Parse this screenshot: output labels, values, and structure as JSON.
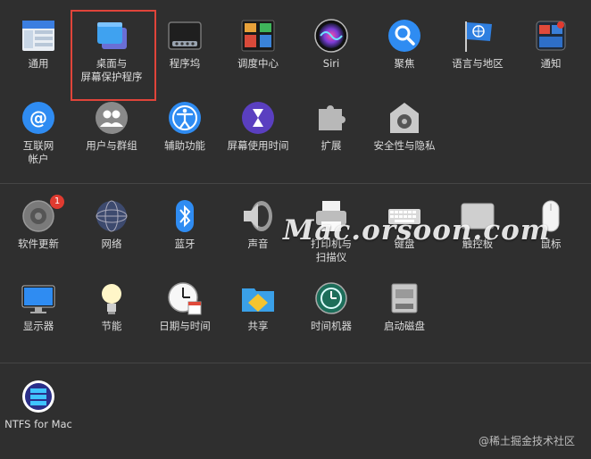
{
  "rows": {
    "row1": [
      {
        "name": "general-pane",
        "icon": "general-icon",
        "label": "通用"
      },
      {
        "name": "desktop-screensaver-pane",
        "icon": "desktop-screensaver-icon",
        "label": "桌面与\n屏幕保护程序"
      },
      {
        "name": "dock-pane",
        "icon": "dock-icon",
        "label": "程序坞"
      },
      {
        "name": "mission-control-pane",
        "icon": "mission-control-icon",
        "label": "调度中心"
      },
      {
        "name": "siri-pane",
        "icon": "siri-icon",
        "label": "Siri"
      },
      {
        "name": "spotlight-pane",
        "icon": "spotlight-icon",
        "label": "聚焦"
      },
      {
        "name": "language-region-pane",
        "icon": "language-region-icon",
        "label": "语言与地区"
      },
      {
        "name": "notifications-pane",
        "icon": "notifications-icon",
        "label": "通知"
      }
    ],
    "row2": [
      {
        "name": "internet-accounts-pane",
        "icon": "internet-accounts-icon",
        "label": "互联网\n帐户"
      },
      {
        "name": "users-groups-pane",
        "icon": "users-groups-icon",
        "label": "用户与群组"
      },
      {
        "name": "accessibility-pane",
        "icon": "accessibility-icon",
        "label": "辅助功能"
      },
      {
        "name": "screen-time-pane",
        "icon": "screen-time-icon",
        "label": "屏幕使用时间"
      },
      {
        "name": "extensions-pane",
        "icon": "extensions-icon",
        "label": "扩展"
      },
      {
        "name": "security-privacy-pane",
        "icon": "security-privacy-icon",
        "label": "安全性与隐私"
      }
    ],
    "row3": [
      {
        "name": "software-update-pane",
        "icon": "software-update-icon",
        "label": "软件更新",
        "badge": "1"
      },
      {
        "name": "network-pane",
        "icon": "network-icon",
        "label": "网络"
      },
      {
        "name": "bluetooth-pane",
        "icon": "bluetooth-icon",
        "label": "蓝牙"
      },
      {
        "name": "sound-pane",
        "icon": "sound-icon",
        "label": "声音"
      },
      {
        "name": "printers-scanners-pane",
        "icon": "printer-icon",
        "label": "打印机与\n扫描仪"
      },
      {
        "name": "keyboard-pane",
        "icon": "keyboard-icon",
        "label": "键盘"
      },
      {
        "name": "trackpad-pane",
        "icon": "trackpad-icon",
        "label": "触控板"
      },
      {
        "name": "mouse-pane",
        "icon": "mouse-icon",
        "label": "鼠标"
      }
    ],
    "row4": [
      {
        "name": "displays-pane",
        "icon": "displays-icon",
        "label": "显示器"
      },
      {
        "name": "energy-saver-pane",
        "icon": "energy-saver-icon",
        "label": "节能"
      },
      {
        "name": "date-time-pane",
        "icon": "date-time-icon",
        "label": "日期与时间"
      },
      {
        "name": "sharing-pane",
        "icon": "sharing-icon",
        "label": "共享"
      },
      {
        "name": "time-machine-pane",
        "icon": "time-machine-icon",
        "label": "时间机器"
      },
      {
        "name": "startup-disk-pane",
        "icon": "startup-disk-icon",
        "label": "启动磁盘"
      }
    ],
    "row5": [
      {
        "name": "ntfs-for-mac-pane",
        "icon": "ntfs-icon",
        "label": "NTFS for Mac"
      }
    ]
  },
  "watermark": "Mac.orsoon.com",
  "credit": "@稀土掘金技术社区",
  "colors": {
    "background": "#2f2f2f",
    "highlight": "#e0443a",
    "badge": "#e03b30",
    "accent": "#2f8cf2"
  }
}
